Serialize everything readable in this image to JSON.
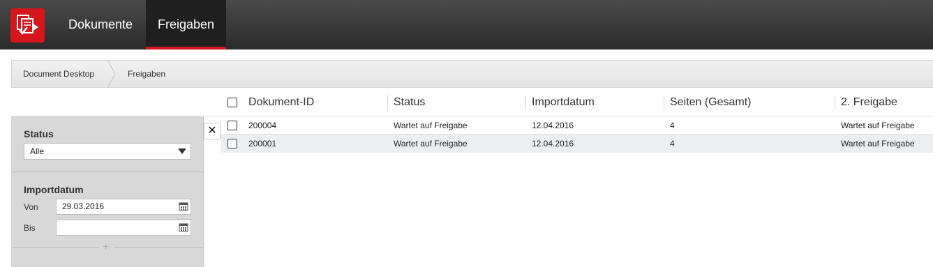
{
  "app": {
    "logo_icon": "document-approval-logo-icon",
    "brand_color": "#d5161c"
  },
  "nav": {
    "items": [
      {
        "label": "Dokumente",
        "active": false
      },
      {
        "label": "Freigaben",
        "active": true
      }
    ]
  },
  "breadcrumb": [
    {
      "label": "Document Desktop"
    },
    {
      "label": "Freigaben"
    }
  ],
  "table": {
    "columns": [
      "Dokument-ID",
      "Status",
      "Importdatum",
      "Seiten (Gesamt)",
      "2. Freigabe"
    ],
    "rows": [
      {
        "id": "200004",
        "status": "Wartet auf Freigabe",
        "import": "12.04.2016",
        "pages": "4",
        "second": "Wartet auf Freigabe"
      },
      {
        "id": "200001",
        "status": "Wartet auf Freigabe",
        "import": "12.04.2016",
        "pages": "4",
        "second": "Wartet auf Freigabe"
      }
    ]
  },
  "filter": {
    "status_label": "Status",
    "status_value": "Alle",
    "import_label": "Importdatum",
    "from_label": "Von",
    "from_value": "29.03.2016",
    "to_label": "Bis",
    "to_value": "",
    "close_symbol": "✕",
    "add_symbol": "+"
  }
}
